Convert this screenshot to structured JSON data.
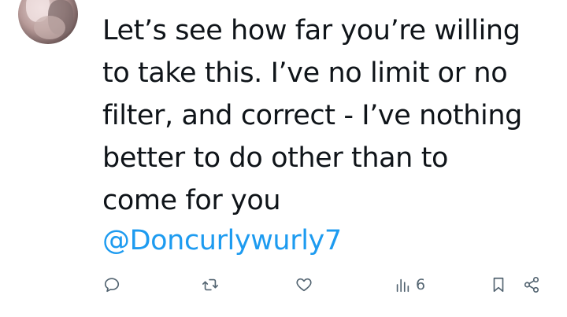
{
  "tweet": {
    "lines": [
      "Let’s see how far you’re willing",
      "to take this. I’ve no limit or no",
      "filter, and correct - I’ve nothing",
      "better to do other than to",
      "come for you"
    ],
    "mention": "@Doncurlywurly7"
  },
  "actions": {
    "reply": {
      "icon": "reply-icon",
      "count": ""
    },
    "retweet": {
      "icon": "retweet-icon",
      "count": ""
    },
    "like": {
      "icon": "heart-icon",
      "count": ""
    },
    "views": {
      "icon": "views-icon",
      "count": "6"
    },
    "bookmark": {
      "icon": "bookmark-icon"
    },
    "share": {
      "icon": "share-icon"
    }
  },
  "colors": {
    "text": "#0f1419",
    "mention": "#1d9bf0",
    "icon": "#536471",
    "background": "#ffffff"
  }
}
